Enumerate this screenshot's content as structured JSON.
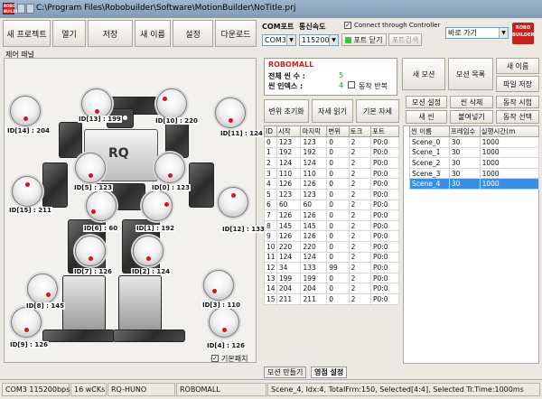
{
  "window": {
    "title": "C:\\Program Files\\Robobuilder\\Software\\MotionBuilder\\NoTitle.prj",
    "app_icon": "ROBO BUILDER"
  },
  "toolbar": [
    "새 프로젝트",
    "열기",
    "저장",
    "새 이름",
    "설정",
    "다운로드"
  ],
  "com": {
    "port_label": "COM포트",
    "speed_label": "통신속도",
    "port_value": "COM3",
    "speed_value": "115200",
    "connect_check": "Connect through Controller",
    "port_close": "포트 닫기",
    "port_search": "포트검색",
    "goto_value": "바로 가기"
  },
  "logo": "ROBO BUILDER",
  "panel_title": "제어 패널",
  "servos": [
    {
      "id": "ID[14] : 204"
    },
    {
      "id": "ID[13] : 199"
    },
    {
      "id": "ID[10] : 220"
    },
    {
      "id": "ID[11] : 124"
    },
    {
      "id": "ID[5] : 123"
    },
    {
      "id": "ID[0] : 123"
    },
    {
      "id": "ID[15] : 211"
    },
    {
      "id": "ID[12] : 133"
    },
    {
      "id": "ID[6] : 60"
    },
    {
      "id": "ID[1] : 192"
    },
    {
      "id": "ID[7] : 126"
    },
    {
      "id": "ID[2] : 124"
    },
    {
      "id": "ID[8] : 145"
    },
    {
      "id": "ID[3] : 110"
    },
    {
      "id": "ID[9] : 126"
    },
    {
      "id": "ID[4] : 126"
    }
  ],
  "basic_pose_check": "기본패치",
  "robomall": "ROBOMALL",
  "info": {
    "total_scenes_label": "전체 씬 수 :",
    "total_scenes": "5",
    "scene_index_label": "씬 인덱스 :",
    "scene_index": "4",
    "repeat_label": "동작 반복"
  },
  "motion_buttons": {
    "new_motion": "새 모션",
    "motion_list": "모션 목록",
    "new_name": "새 이름",
    "file_save": "파일 저장"
  },
  "action_buttons": {
    "init": "변위 초기화",
    "read_pose": "자세 읽기",
    "basic_pose": "기본 자세"
  },
  "scene_buttons": {
    "motion_settings": "모션 설정",
    "scene_delete": "씬 삭제",
    "motion_test": "동작 시험",
    "new_scene": "새 씬",
    "paste": "붙여넣기",
    "motion_select": "동작 선택"
  },
  "servo_table": {
    "columns": [
      "ID",
      "시작",
      "마지막",
      "변위",
      "토크",
      "포트"
    ],
    "rows": [
      [
        "0",
        "123",
        "123",
        "0",
        "2",
        "P0:0"
      ],
      [
        "1",
        "192",
        "192",
        "0",
        "2",
        "P0:0"
      ],
      [
        "2",
        "124",
        "124",
        "0",
        "2",
        "P0:0"
      ],
      [
        "3",
        "110",
        "110",
        "0",
        "2",
        "P0:0"
      ],
      [
        "4",
        "126",
        "126",
        "0",
        "2",
        "P0:0"
      ],
      [
        "5",
        "123",
        "123",
        "0",
        "2",
        "P0:0"
      ],
      [
        "6",
        "60",
        "60",
        "0",
        "2",
        "P0:0"
      ],
      [
        "7",
        "126",
        "126",
        "0",
        "2",
        "P0:0"
      ],
      [
        "8",
        "145",
        "145",
        "0",
        "2",
        "P0:0"
      ],
      [
        "9",
        "126",
        "126",
        "0",
        "2",
        "P0:0"
      ],
      [
        "10",
        "220",
        "220",
        "0",
        "2",
        "P0:0"
      ],
      [
        "11",
        "124",
        "124",
        "0",
        "2",
        "P0:0"
      ],
      [
        "12",
        "34",
        "133",
        "99",
        "2",
        "P0:0"
      ],
      [
        "13",
        "199",
        "199",
        "0",
        "2",
        "P0:0"
      ],
      [
        "14",
        "204",
        "204",
        "0",
        "2",
        "P0:0"
      ],
      [
        "15",
        "211",
        "211",
        "0",
        "2",
        "P0:0"
      ]
    ]
  },
  "scene_table": {
    "columns": [
      "씬 이름",
      "프레임수",
      "실행시간(m"
    ],
    "rows": [
      [
        "Scene_0",
        "30",
        "1000"
      ],
      [
        "Scene_1",
        "30",
        "1000"
      ],
      [
        "Scene_2",
        "30",
        "1000"
      ],
      [
        "Scene_3",
        "30",
        "1000"
      ],
      [
        "Scene_4",
        "30",
        "1000"
      ]
    ],
    "selected": 4
  },
  "tabs": [
    "모션 만들기",
    "영점 설정"
  ],
  "status": [
    "COM3 115200bps",
    "16 wCKs",
    "RQ-HUNO",
    "ROBOMALL",
    "Scene_4, Idx:4, TotalFrm:150, Selected[4:4], Selected Tr.Time:1000ms"
  ]
}
